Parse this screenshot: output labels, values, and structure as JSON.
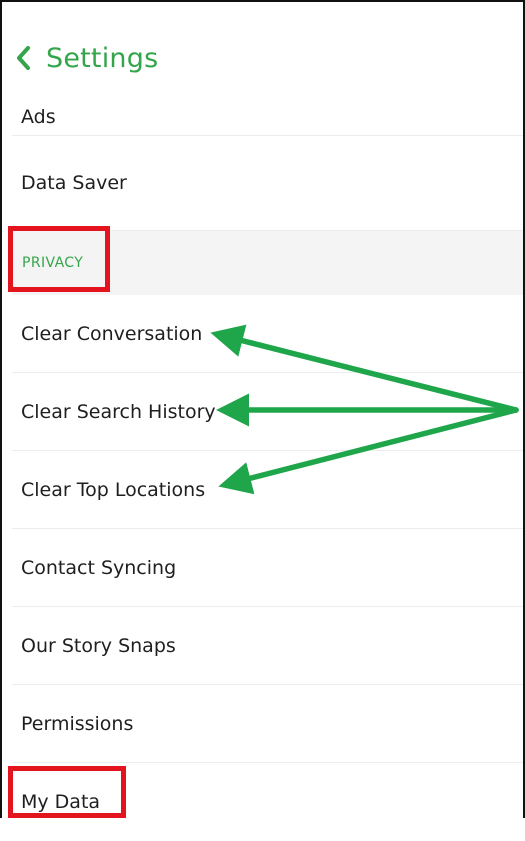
{
  "header": {
    "title": "Settings",
    "back_icon": "chevron-left-icon"
  },
  "rows_before": [
    {
      "label": "Ads"
    },
    {
      "label": "Data Saver"
    }
  ],
  "section": {
    "label": "PRIVACY"
  },
  "rows_after": [
    {
      "label": "Clear Conversation"
    },
    {
      "label": "Clear Search History"
    },
    {
      "label": "Clear Top Locations"
    },
    {
      "label": "Contact Syncing"
    },
    {
      "label": "Our Story Snaps"
    },
    {
      "label": "Permissions"
    },
    {
      "label": "My Data"
    }
  ],
  "colors": {
    "accent": "#35a54b",
    "highlight": "#e3141d",
    "arrow": "#1fa64a"
  }
}
